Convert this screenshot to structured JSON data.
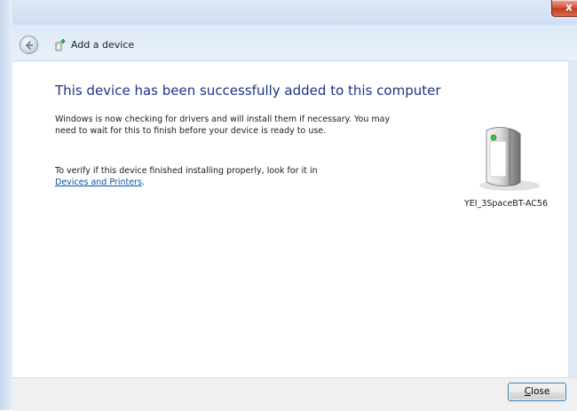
{
  "window": {
    "close_glyph": "x"
  },
  "nav": {
    "back_icon": "back-arrow-icon",
    "dialog_icon": "add-device-icon",
    "title": "Add a device"
  },
  "main": {
    "headline": "This device has been successfully added to this computer",
    "paragraph1": "Windows is now checking for drivers and will install them if necessary. You may need to wait for this to finish before your device is ready to use.",
    "paragraph2_text": "To verify if this device finished installing properly, look for it in",
    "paragraph2_link": "Devices and Printers",
    "paragraph2_end": "."
  },
  "device": {
    "icon": "generic-device-icon",
    "name": "YEI_3SpaceBT-AC56"
  },
  "footer": {
    "close_label_mnemonic": "C",
    "close_label_rest": "lose"
  },
  "colors": {
    "headline": "#1e3287",
    "link": "#0b4fa3",
    "close_x_red": "#c43b23"
  }
}
